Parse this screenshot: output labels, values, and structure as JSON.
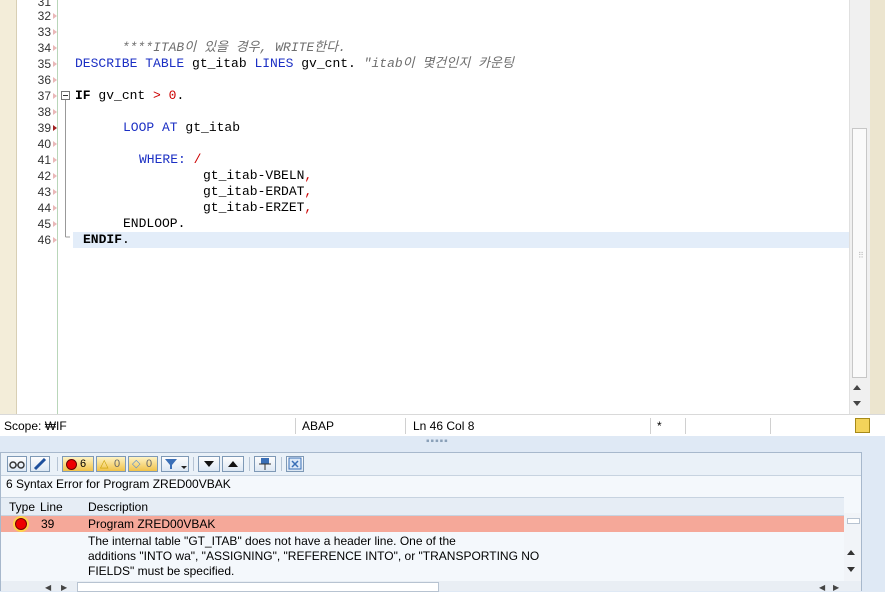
{
  "editor": {
    "lines": [
      {
        "num": "31",
        "text": ""
      },
      {
        "num": "32",
        "text": ""
      },
      {
        "num": "33",
        "text": "****ITAB이 있을 경우, WRITE한다."
      },
      {
        "num": "34",
        "text": ""
      },
      {
        "num": "35",
        "parts": [
          "DESCRIBE TABLE",
          " gt_itab ",
          "LINES",
          " gv_cnt. ",
          "\"itab이 몇건인지 카운팅"
        ]
      },
      {
        "num": "36",
        "text": ""
      },
      {
        "num": "37",
        "parts": [
          "IF",
          " gv_cnt ",
          ">",
          " ",
          "0",
          "."
        ]
      },
      {
        "num": "38",
        "text": ""
      },
      {
        "num": "39",
        "parts": [
          "LOOP AT",
          " gt_itab"
        ]
      },
      {
        "num": "40",
        "text": ""
      },
      {
        "num": "41",
        "parts": [
          "WHERE:",
          " ",
          "/"
        ]
      },
      {
        "num": "42",
        "parts": [
          "gt_itab-VBELN",
          ","
        ]
      },
      {
        "num": "43",
        "parts": [
          "gt_itab-ERDAT",
          ","
        ]
      },
      {
        "num": "44",
        "parts": [
          "gt_itab-ERZET",
          ","
        ]
      },
      {
        "num": "45",
        "text": "ENDLOOP."
      },
      {
        "num": "46",
        "parts": [
          "ENDIF",
          "."
        ]
      }
    ]
  },
  "status": {
    "scope": "Scope: ₩IF",
    "language": "ABAP",
    "position": "Ln  46 Col   8",
    "modified": "*"
  },
  "errors": {
    "toolbar": {
      "error_count": "6",
      "warning_count": "0",
      "info_count": "0"
    },
    "title": "6 Syntax Error for Program ZRED00VBAK",
    "columns": {
      "type": "Type",
      "line": "Line",
      "description": "Description"
    },
    "row": {
      "line": "39",
      "program": "Program ZRED00VBAK",
      "detail": [
        "The internal table \"GT_ITAB\" does not have a header line. One of the",
        "additions \"INTO wa\", \"ASSIGNING\", \"REFERENCE INTO\", or \"TRANSPORTING NO",
        "FIELDS\" must be specified."
      ]
    }
  },
  "colors": {
    "keyword": "#1b2fc4",
    "comment": "#6e6e6e",
    "number": "#cc0000",
    "error_row": "#f5a899",
    "current_line": "#e3edf9"
  }
}
